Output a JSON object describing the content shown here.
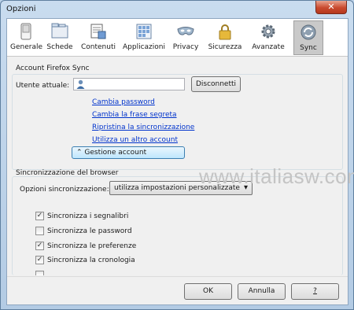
{
  "window": {
    "title": "Opzioni",
    "close_symbol": "✕"
  },
  "toolbar": {
    "items": [
      {
        "label": "Generale",
        "icon": "switch-icon"
      },
      {
        "label": "Schede",
        "icon": "tabs-icon"
      },
      {
        "label": "Contenuti",
        "icon": "content-icon"
      },
      {
        "label": "Applicazioni",
        "icon": "applications-icon"
      },
      {
        "label": "Privacy",
        "icon": "mask-icon"
      },
      {
        "label": "Sicurezza",
        "icon": "padlock-icon"
      },
      {
        "label": "Avanzate",
        "icon": "gear-icon"
      },
      {
        "label": "Sync",
        "icon": "sync-icon"
      }
    ],
    "selected": "Sync"
  },
  "account": {
    "group_title": "Account Firefox Sync",
    "current_user_label": "Utente attuale:",
    "current_user_value": "",
    "disconnect_label": "Disconnetti",
    "links": [
      "Cambia password",
      "Cambia la frase segreta",
      "Ripristina la sincronizzazione",
      "Utilizza un altro account"
    ],
    "manage_label": "Gestione account",
    "manage_symbol": "⌃"
  },
  "sync": {
    "group_title": "Sincronizzazione del browser",
    "options_label": "Opzioni sincronizzazione:",
    "options_value": "utilizza impostazioni personalizzate",
    "options_arrow": "▾",
    "items": [
      {
        "label": "Sincronizza i segnalibri",
        "checked": true,
        "mark": "✓"
      },
      {
        "label": "Sincronizza le password",
        "checked": false,
        "mark": ""
      },
      {
        "label": "Sincronizza le preferenze",
        "checked": true,
        "mark": "✓"
      },
      {
        "label": "Sincronizza la cronologia",
        "checked": true,
        "mark": "✓"
      }
    ]
  },
  "watermark": "www.italiasw.com",
  "buttons": {
    "ok": "OK",
    "cancel": "Annulla",
    "help": "?"
  }
}
